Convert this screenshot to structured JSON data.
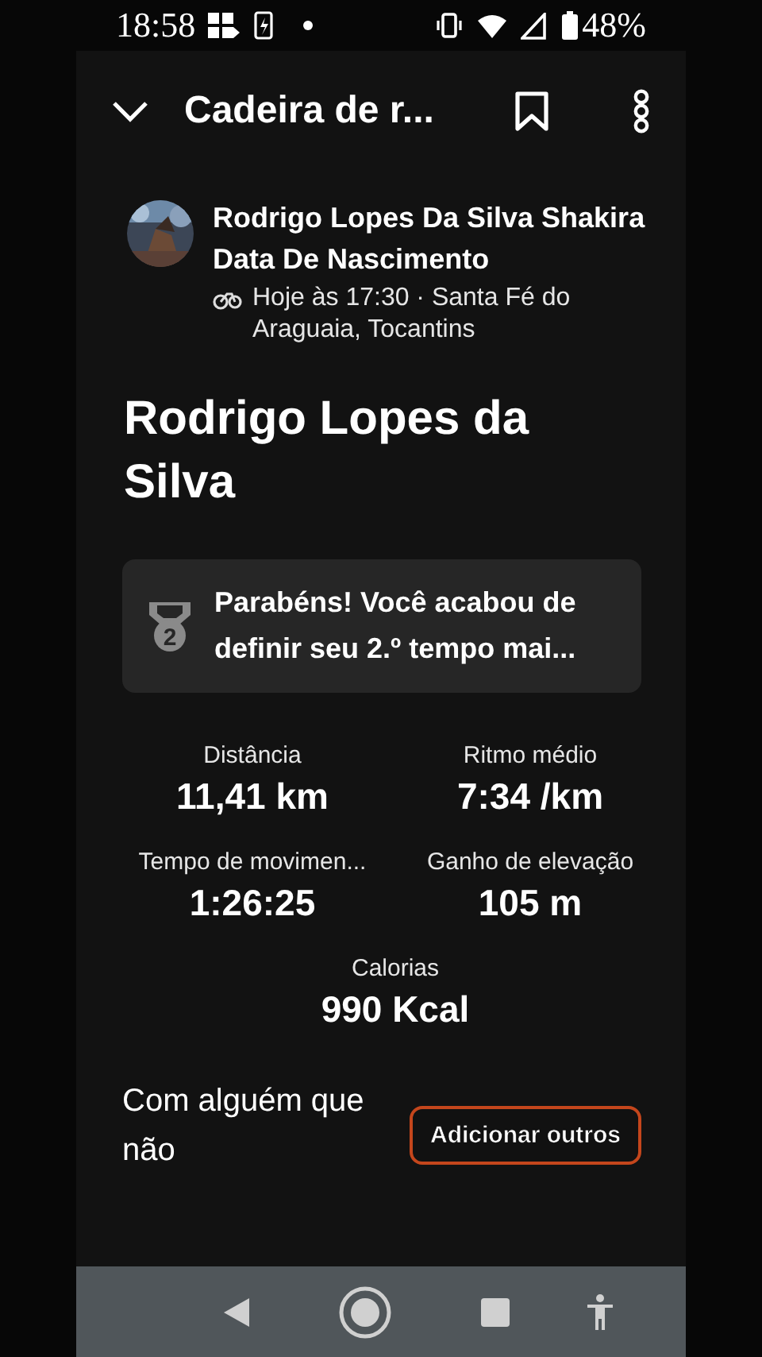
{
  "status_bar": {
    "time": "18:58",
    "battery": "48%"
  },
  "header": {
    "title": "Cadeira de r..."
  },
  "athlete": {
    "name": "Rodrigo Lopes Da Silva Shakira Data De Nascimento",
    "meta": "Hoje às 17:30 · Santa Fé do Araguaia, Tocantins"
  },
  "activity_title": "Rodrigo Lopes da Silva",
  "achievement": {
    "rank": "2",
    "text": "Parabéns! Você acabou de definir seu 2.º tempo mai..."
  },
  "stats": [
    {
      "label": "Distância",
      "value": "11,41 km"
    },
    {
      "label": "Ritmo médio",
      "value": "7:34 /km"
    },
    {
      "label": "Tempo de movimen...",
      "value": "1:26:25"
    },
    {
      "label": "Ganho de elevação",
      "value": "105 m"
    },
    {
      "label": "Calorias",
      "value": "990 Kcal"
    }
  ],
  "companions": {
    "prompt": "Com alguém que não",
    "button": "Adicionar outros"
  }
}
